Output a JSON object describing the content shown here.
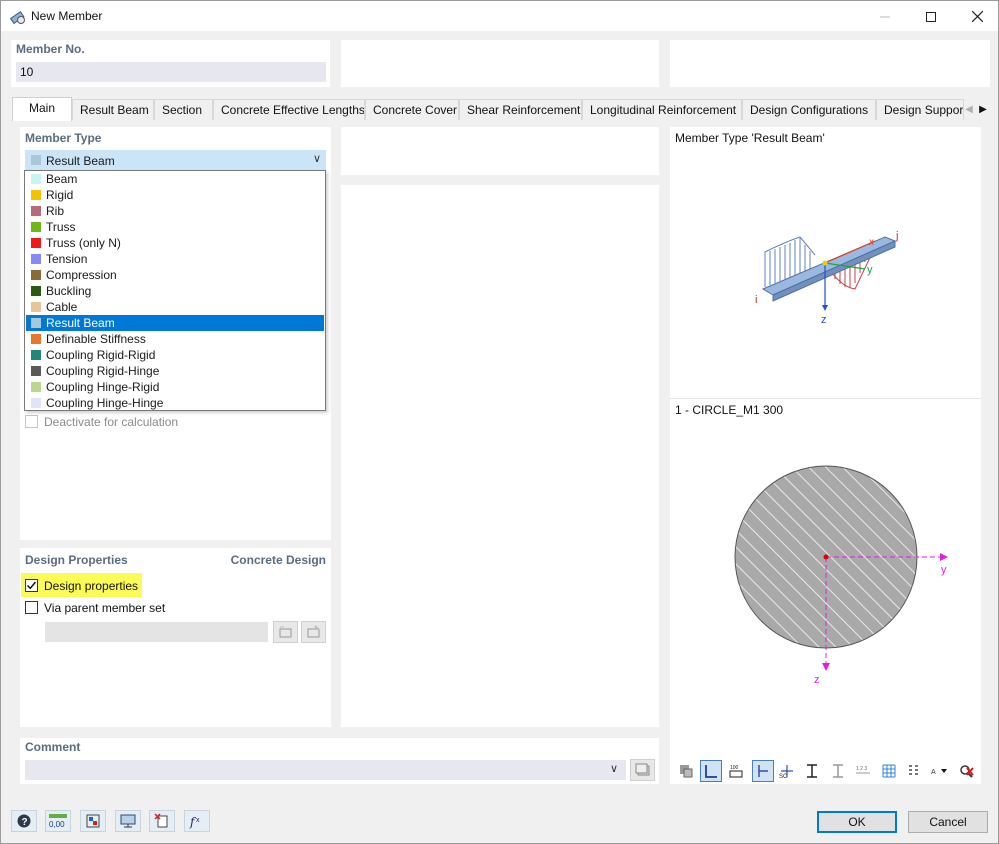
{
  "window": {
    "title": "New Member"
  },
  "member_no": {
    "label": "Member No.",
    "value": "10"
  },
  "tabs": [
    {
      "label": "Main",
      "active": true
    },
    {
      "label": "Result Beam"
    },
    {
      "label": "Section"
    },
    {
      "label": "Concrete Effective Lengths"
    },
    {
      "label": "Concrete Cover"
    },
    {
      "label": "Shear Reinforcement"
    },
    {
      "label": "Longitudinal Reinforcement"
    },
    {
      "label": "Design Configurations"
    },
    {
      "label": "Design Suppor"
    }
  ],
  "member_type": {
    "label": "Member Type",
    "selected": "Result Beam",
    "selected_color": "#a8c8d8",
    "options": [
      {
        "label": "Beam",
        "color": "#c8f4f4"
      },
      {
        "label": "Rigid",
        "color": "#f2c200"
      },
      {
        "label": "Rib",
        "color": "#b86a78"
      },
      {
        "label": "Truss",
        "color": "#70b818"
      },
      {
        "label": "Truss (only N)",
        "color": "#f01818"
      },
      {
        "label": "Tension",
        "color": "#8888f8"
      },
      {
        "label": "Compression",
        "color": "#8a6a38"
      },
      {
        "label": "Buckling",
        "color": "#2a5a10"
      },
      {
        "label": "Cable",
        "color": "#e8c498"
      },
      {
        "label": "Result Beam",
        "color": "#a8c8d8",
        "selected": true
      },
      {
        "label": "Definable Stiffness",
        "color": "#e87830"
      },
      {
        "label": "Coupling Rigid-Rigid",
        "color": "#208878"
      },
      {
        "label": "Coupling Rigid-Hinge",
        "color": "#5a5a5a"
      },
      {
        "label": "Coupling Hinge-Rigid",
        "color": "#b8d890"
      },
      {
        "label": "Coupling Hinge-Hinge",
        "color": "#e0e4f8"
      }
    ]
  },
  "deactivate": {
    "label": "Deactivate for calculation",
    "checked": false,
    "enabled": false
  },
  "design_properties": {
    "title": "Design Properties",
    "module": "Concrete Design",
    "design_properties_label": "Design properties",
    "design_properties_checked": true,
    "via_parent_label": "Via parent member set",
    "via_parent_checked": false
  },
  "comment": {
    "label": "Comment",
    "value": ""
  },
  "preview": {
    "member_type_caption": "Member Type 'Result Beam'",
    "section_caption": "1 - CIRCLE_M1 300",
    "beam_labels": {
      "i": "i",
      "j": "j",
      "x": "x",
      "y": "y",
      "z": "z"
    },
    "section_axes": {
      "y": "y",
      "z": "z"
    }
  },
  "preview_toolbar": [
    {
      "icon": "render-options-icon"
    },
    {
      "icon": "section-outline-icon",
      "active": true
    },
    {
      "icon": "dimensions-icon"
    },
    {
      "icon": "centroid-axes-icon",
      "active": true
    },
    {
      "icon": "principal-axes-icon"
    },
    {
      "icon": "shear-center-icon"
    },
    {
      "icon": "stress-points-icon"
    },
    {
      "icon": "part-numbering-icon"
    },
    {
      "icon": "grid-icon"
    },
    {
      "icon": "labels-icon"
    },
    {
      "icon": "display-settings-icon"
    },
    {
      "icon": "reset-view-icon"
    }
  ],
  "buttons": {
    "ok": "OK",
    "cancel": "Cancel"
  }
}
